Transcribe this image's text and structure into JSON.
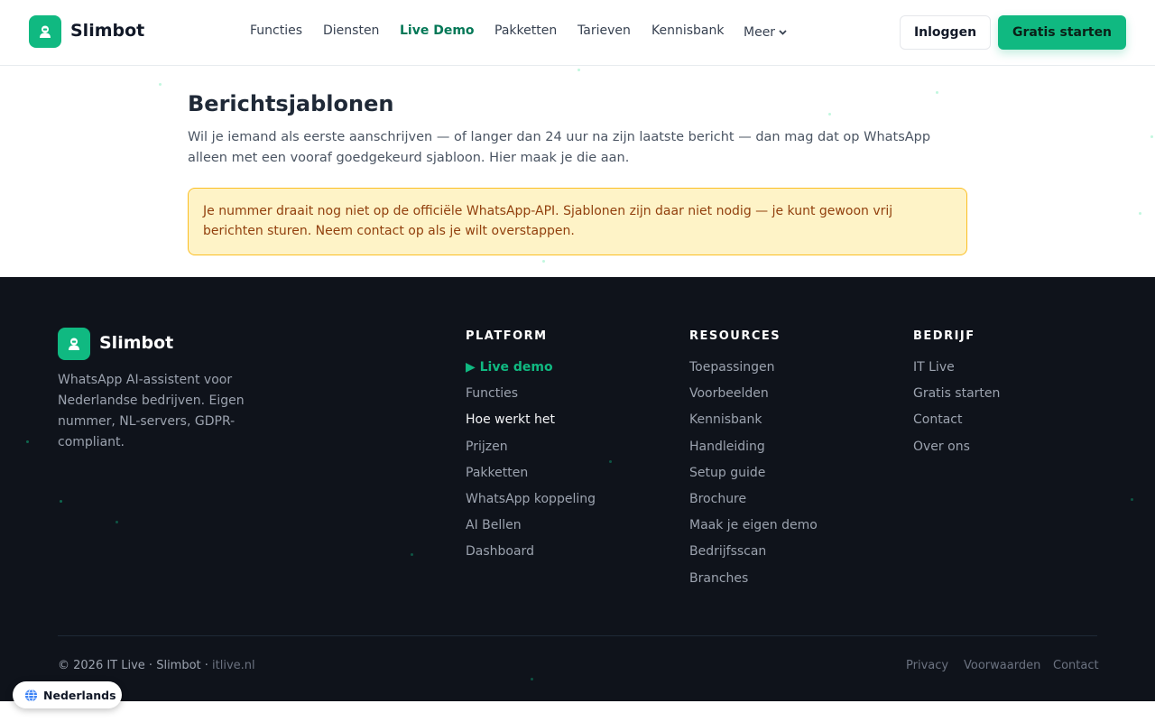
{
  "brand": {
    "name": "Slimbot"
  },
  "nav": {
    "items": [
      "Functies",
      "Diensten",
      "Live Demo",
      "Pakketten",
      "Tarieven",
      "Kennisbank"
    ],
    "more_label": "Meer",
    "active": "Live Demo",
    "login_label": "Inloggen",
    "cta_label": "Gratis starten"
  },
  "main": {
    "title": "Berichtsjablonen",
    "description": "Wil je iemand als eerste aanschrijven — of langer dan 24 uur na zijn laatste bericht — dan mag dat op WhatsApp alleen met een vooraf goedgekeurd sjabloon. Hier maak je die aan.",
    "notice": "Je nummer draait nog niet op de officiële WhatsApp-API. Sjablonen zijn daar niet nodig — je kunt gewoon vrij berichten sturen. Neem contact op als je wilt overstappen."
  },
  "footer": {
    "brand": "Slimbot",
    "description": "WhatsApp AI-assistent voor Nederlandse bedrijven. Eigen nummer, NL-servers, GDPR-compliant.",
    "columns": [
      {
        "heading": "PLATFORM",
        "links": [
          "▶ Live demo",
          "Functies",
          "Hoe werkt het",
          "Prijzen",
          "Pakketten",
          "WhatsApp koppeling",
          "AI Bellen",
          "Dashboard"
        ]
      },
      {
        "heading": "RESOURCES",
        "links": [
          "Toepassingen",
          "Voorbeelden",
          "Kennisbank",
          "Handleiding",
          "Setup guide",
          "Brochure",
          "Maak je eigen demo",
          "Bedrijfsscan",
          "Branches"
        ]
      },
      {
        "heading": "BEDRIJF",
        "links": [
          "IT Live",
          "Gratis starten",
          "Contact",
          "Over ons"
        ]
      }
    ],
    "copyright": "© 2026 IT Live · Slimbot ·",
    "site": "itlive.nl",
    "legal": [
      "Privacy",
      "Voorwaarden",
      "Contact"
    ]
  },
  "language": {
    "label": "Nederlands",
    "icon": "globe-icon"
  },
  "colors": {
    "accent": "#10b981",
    "active_nav": "#047857",
    "footer_bg": "#0f131b",
    "notice_bg": "#fef3c7",
    "notice_border": "#fbbf24",
    "notice_text": "#92400e"
  }
}
